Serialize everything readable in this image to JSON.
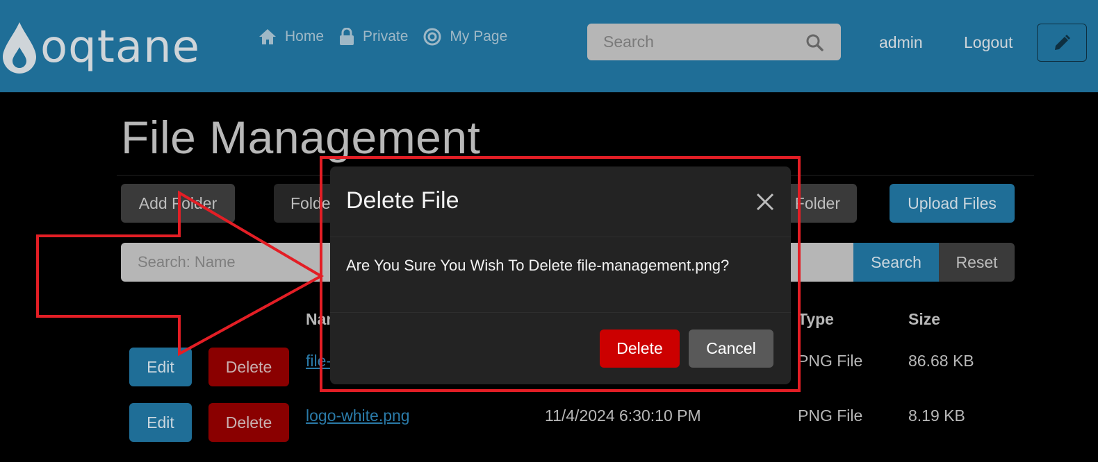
{
  "header": {
    "logo_text": "oqtane",
    "nav": [
      {
        "label": "Home",
        "icon": "home-icon"
      },
      {
        "label": "Private",
        "icon": "lock-icon"
      },
      {
        "label": "My Page",
        "icon": "target-icon"
      }
    ],
    "search_placeholder": "Search",
    "user": "admin",
    "logout": "Logout"
  },
  "page": {
    "title": "File Management",
    "toolbar": {
      "add_folder": "Add Folder",
      "folder_left": "Folde",
      "folder_right": "Folder",
      "upload_files": "Upload Files"
    },
    "filter": {
      "placeholder": "Search: Name",
      "search": "Search",
      "reset": "Reset"
    },
    "table": {
      "headers": {
        "name": "Nam",
        "type": "Type",
        "size": "Size"
      },
      "rows": [
        {
          "edit": "Edit",
          "delete": "Delete",
          "name": "file-",
          "modified": "",
          "type": "PNG File",
          "size": "86.68 KB"
        },
        {
          "edit": "Edit",
          "delete": "Delete",
          "name": "logo-white.png",
          "modified": "11/4/2024 6:30:10 PM",
          "type": "PNG File",
          "size": "8.19 KB"
        }
      ]
    }
  },
  "modal": {
    "title": "Delete File",
    "message": "Are You Sure You Wish To Delete file-management.png?",
    "delete": "Delete",
    "cancel": "Cancel"
  },
  "colors": {
    "header_bg": "#1f6e97",
    "annotation": "#e31e25",
    "danger": "#cc0000"
  }
}
